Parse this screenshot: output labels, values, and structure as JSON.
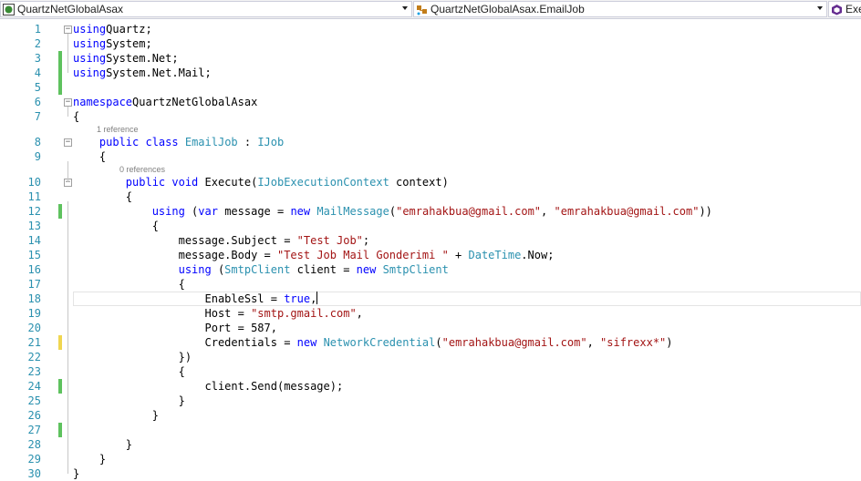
{
  "navbar": {
    "project": "QuartzNetGlobalAsax",
    "type": "QuartzNetGlobalAsax.EmailJob",
    "member": "Exe"
  },
  "codelens": {
    "class_refs": "1 reference",
    "method_refs": "0 references"
  },
  "lines": [
    {
      "n": "1",
      "tokens": [
        [
          "kw",
          "using"
        ],
        [
          "",
          "Quartz;"
        ]
      ]
    },
    {
      "n": "2",
      "tokens": [
        [
          "kw",
          "using"
        ],
        [
          "",
          "System;"
        ]
      ]
    },
    {
      "n": "3",
      "tokens": [
        [
          "kw",
          "using"
        ],
        [
          "",
          "System.Net;"
        ]
      ]
    },
    {
      "n": "4",
      "tokens": [
        [
          "kw",
          "using"
        ],
        [
          "",
          "System.Net.Mail;"
        ]
      ]
    },
    {
      "n": "5",
      "tokens": []
    },
    {
      "n": "6",
      "tokens": [
        [
          "kw",
          "namespace"
        ],
        [
          "",
          "QuartzNetGlobalAsax"
        ]
      ]
    },
    {
      "n": "7",
      "tokens": [
        [
          "",
          "{"
        ]
      ]
    },
    {
      "n": "8",
      "tokens": [
        [
          "",
          "    "
        ],
        [
          "kw",
          "public class"
        ],
        [
          "",
          " "
        ],
        [
          "ty",
          "EmailJob"
        ],
        [
          "",
          " : "
        ],
        [
          "ty",
          "IJob"
        ]
      ]
    },
    {
      "n": "9",
      "tokens": [
        [
          "",
          "    {"
        ]
      ]
    },
    {
      "n": "10",
      "tokens": [
        [
          "",
          "        "
        ],
        [
          "kw",
          "public void"
        ],
        [
          "",
          " Execute("
        ],
        [
          "ty",
          "IJobExecutionContext"
        ],
        [
          "",
          " context)"
        ]
      ]
    },
    {
      "n": "11",
      "tokens": [
        [
          "",
          "        {"
        ]
      ]
    },
    {
      "n": "12",
      "tokens": [
        [
          "",
          "            "
        ],
        [
          "kw",
          "using"
        ],
        [
          "",
          " ("
        ],
        [
          "kw",
          "var"
        ],
        [
          "",
          " message = "
        ],
        [
          "kw",
          "new"
        ],
        [
          "",
          " "
        ],
        [
          "ty",
          "MailMessage"
        ],
        [
          "",
          "("
        ],
        [
          "st",
          "\"emrahakbua@gmail.com\""
        ],
        [
          "",
          ", "
        ],
        [
          "st",
          "\"emrahakbua@gmail.com\""
        ],
        [
          "",
          "))"
        ]
      ]
    },
    {
      "n": "13",
      "tokens": [
        [
          "",
          "            {"
        ]
      ]
    },
    {
      "n": "14",
      "tokens": [
        [
          "",
          "                message.Subject = "
        ],
        [
          "st",
          "\"Test Job\""
        ],
        [
          "",
          ";"
        ]
      ]
    },
    {
      "n": "15",
      "tokens": [
        [
          "",
          "                message.Body = "
        ],
        [
          "st",
          "\"Test Job Mail Gonderimi \""
        ],
        [
          "",
          " + "
        ],
        [
          "ty",
          "DateTime"
        ],
        [
          "",
          ".Now;"
        ]
      ]
    },
    {
      "n": "16",
      "tokens": [
        [
          "",
          "                "
        ],
        [
          "kw",
          "using"
        ],
        [
          "",
          " ("
        ],
        [
          "ty",
          "SmtpClient"
        ],
        [
          "",
          " client = "
        ],
        [
          "kw",
          "new"
        ],
        [
          "",
          " "
        ],
        [
          "ty",
          "SmtpClient"
        ]
      ]
    },
    {
      "n": "17",
      "tokens": [
        [
          "",
          "                {"
        ]
      ]
    },
    {
      "n": "18",
      "tokens": [
        [
          "",
          "                    EnableSsl = "
        ],
        [
          "kw",
          "true"
        ],
        [
          "",
          ","
        ]
      ]
    },
    {
      "n": "19",
      "tokens": [
        [
          "",
          "                    Host = "
        ],
        [
          "st",
          "\"smtp.gmail.com\""
        ],
        [
          "",
          ","
        ]
      ]
    },
    {
      "n": "20",
      "tokens": [
        [
          "",
          "                    Port = 587,"
        ]
      ]
    },
    {
      "n": "21",
      "tokens": [
        [
          "",
          "                    Credentials = "
        ],
        [
          "kw",
          "new"
        ],
        [
          "",
          " "
        ],
        [
          "ty",
          "NetworkCredential"
        ],
        [
          "",
          "("
        ],
        [
          "st",
          "\"emrahakbua@gmail.com\""
        ],
        [
          "",
          ", "
        ],
        [
          "st",
          "\"sifrexx*\""
        ],
        [
          "",
          ")"
        ]
      ]
    },
    {
      "n": "22",
      "tokens": [
        [
          "",
          "                })"
        ]
      ]
    },
    {
      "n": "23",
      "tokens": [
        [
          "",
          "                {"
        ]
      ]
    },
    {
      "n": "24",
      "tokens": [
        [
          "",
          "                    client.Send(message);"
        ]
      ]
    },
    {
      "n": "25",
      "tokens": [
        [
          "",
          "                }"
        ]
      ]
    },
    {
      "n": "26",
      "tokens": [
        [
          "",
          "            }"
        ]
      ]
    },
    {
      "n": "27",
      "tokens": []
    },
    {
      "n": "28",
      "tokens": [
        [
          "",
          "        }"
        ]
      ]
    },
    {
      "n": "29",
      "tokens": [
        [
          "",
          "    }"
        ]
      ]
    },
    {
      "n": "30",
      "tokens": [
        [
          "",
          "}"
        ]
      ]
    }
  ],
  "change_markers": {
    "3": "#5ec25e",
    "4": "#5ec25e",
    "5": "#5ec25e",
    "12": "#5ec25e",
    "21": "#f0d650",
    "24": "#5ec25e",
    "27": "#5ec25e"
  },
  "colors": {
    "keyword": "#0000ff",
    "type": "#2b91af",
    "string": "#a31515",
    "line_number": "#2b91af"
  }
}
